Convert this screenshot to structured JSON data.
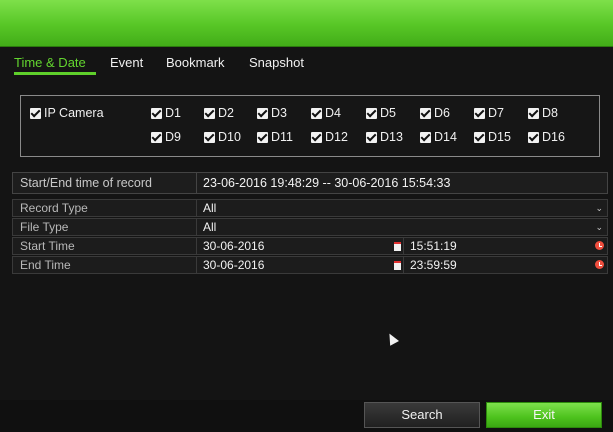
{
  "tabs": [
    {
      "label": "Time & Date",
      "active": true
    },
    {
      "label": "Event",
      "active": false
    },
    {
      "label": "Bookmark",
      "active": false
    },
    {
      "label": "Snapshot",
      "active": false
    }
  ],
  "cameras": {
    "all_label": "IP Camera",
    "all_checked": true,
    "channels": [
      {
        "label": "D1",
        "checked": true
      },
      {
        "label": "D2",
        "checked": true
      },
      {
        "label": "D3",
        "checked": true
      },
      {
        "label": "D4",
        "checked": true
      },
      {
        "label": "D5",
        "checked": true
      },
      {
        "label": "D6",
        "checked": true
      },
      {
        "label": "D7",
        "checked": true
      },
      {
        "label": "D8",
        "checked": true
      },
      {
        "label": "D9",
        "checked": true
      },
      {
        "label": "D10",
        "checked": true
      },
      {
        "label": "D11",
        "checked": true
      },
      {
        "label": "D12",
        "checked": true
      },
      {
        "label": "D13",
        "checked": true
      },
      {
        "label": "D14",
        "checked": true
      },
      {
        "label": "D15",
        "checked": true
      },
      {
        "label": "D16",
        "checked": true
      }
    ]
  },
  "record_range": {
    "label": "Start/End time of record",
    "value": "23-06-2016 19:48:29 -- 30-06-2016 15:54:33"
  },
  "form": {
    "record_type": {
      "label": "Record Type",
      "value": "All"
    },
    "file_type": {
      "label": "File Type",
      "value": "All"
    },
    "start_time": {
      "label": "Start Time",
      "date": "30-06-2016",
      "time": "15:51:19"
    },
    "end_time": {
      "label": "End Time",
      "date": "30-06-2016",
      "time": "23:59:59"
    }
  },
  "buttons": {
    "search": "Search",
    "exit": "Exit"
  },
  "colors": {
    "accent": "#5fd02b",
    "background": "#141414"
  },
  "icons": {
    "calendar": "calendar-icon",
    "clock": "clock-icon",
    "dropdown": "chevron-down-icon"
  }
}
